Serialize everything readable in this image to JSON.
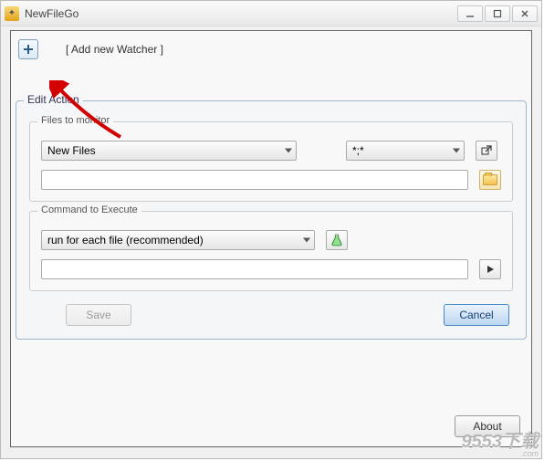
{
  "window": {
    "title": "NewFileGo"
  },
  "top": {
    "add_label": "[ Add new Watcher ]"
  },
  "dialog": {
    "title": "Edit Action",
    "files_section": {
      "legend": "Files to monitor",
      "filetype_select": "New Files",
      "pattern_value": "*;*",
      "path_value": ""
    },
    "command_section": {
      "legend": "Command to Execute",
      "mode_select": "run for each file  (recommended)",
      "command_value": ""
    },
    "buttons": {
      "save": "Save",
      "cancel": "Cancel"
    }
  },
  "footer": {
    "about": "About"
  },
  "watermark": {
    "big": "9553",
    "small": ".com"
  }
}
